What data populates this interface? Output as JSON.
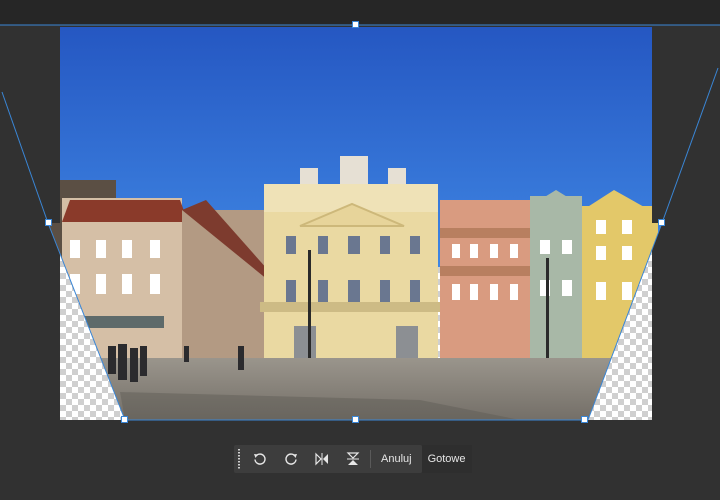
{
  "toolbar": {
    "cancel_label": "Anuluj",
    "done_label": "Gotowe",
    "icons": [
      "rotate-left-icon",
      "rotate-right-icon",
      "flip-horizontal-icon",
      "flip-vertical-icon"
    ]
  },
  "colors": {
    "workspace": "#313131",
    "toolbar": "#3d3d3d",
    "guide": "#3a86d6",
    "sky": "#2b63c8"
  }
}
